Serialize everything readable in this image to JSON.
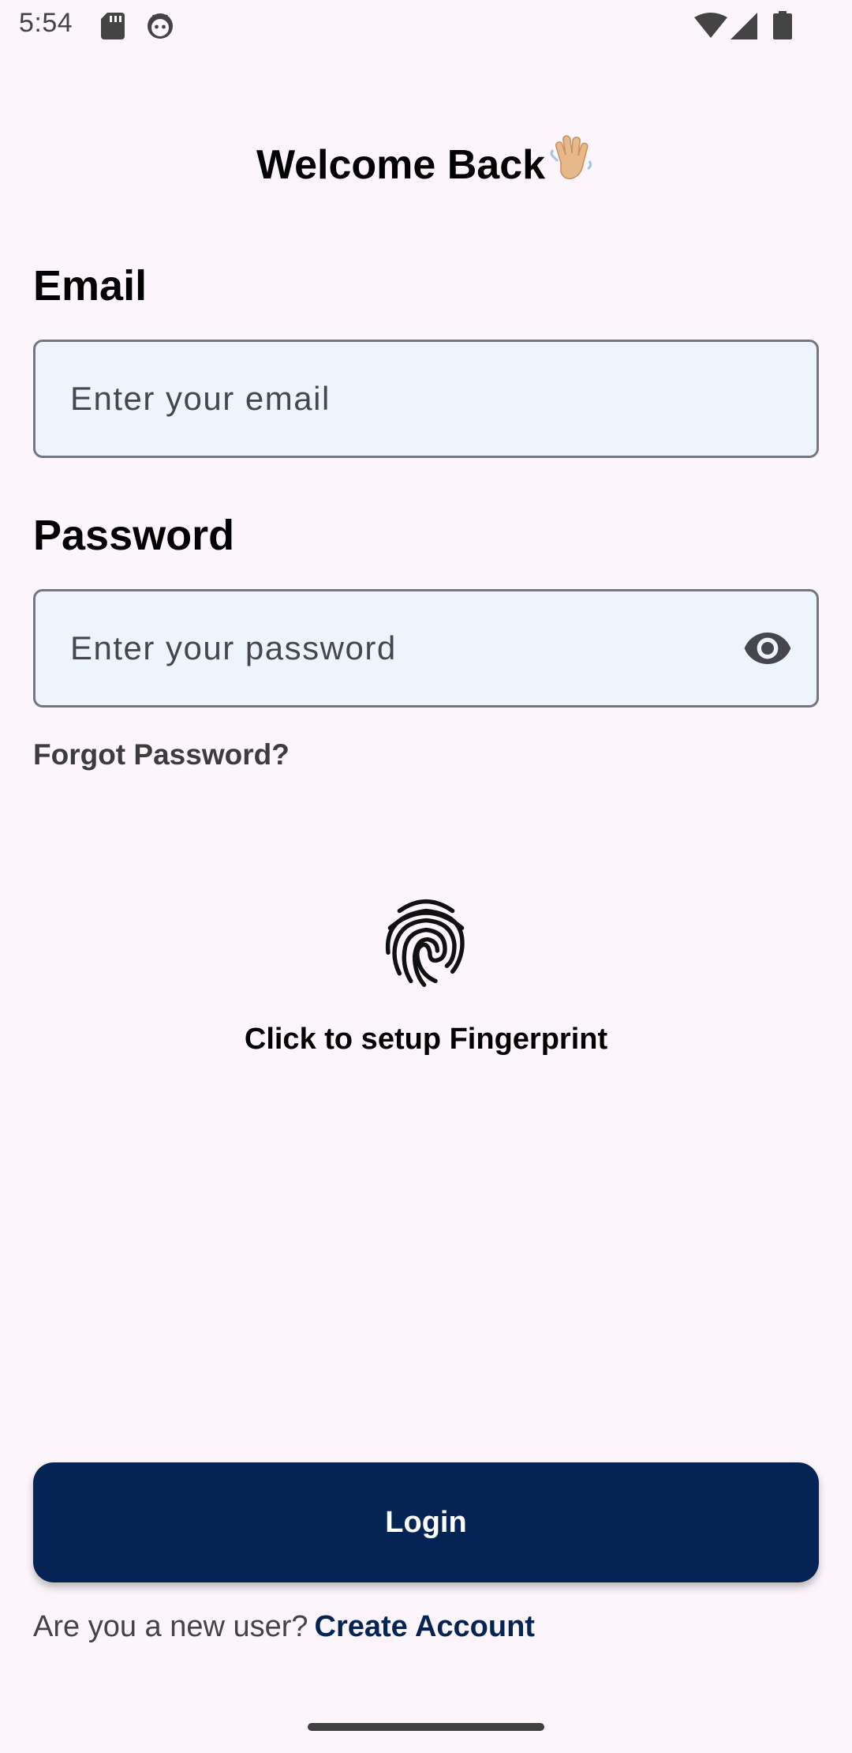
{
  "status_bar": {
    "time": "5:54",
    "left_icons": [
      "sd-card-icon",
      "android-face-icon"
    ],
    "right_icons": [
      "wifi-icon",
      "signal-icon",
      "battery-icon"
    ]
  },
  "header": {
    "title": "Welcome Back",
    "title_emoji": "waving-hand-icon"
  },
  "form": {
    "email_label": "Email",
    "email_placeholder": "Enter your email",
    "password_label": "Password",
    "password_placeholder": "Enter your password",
    "password_toggle_icon": "eye-icon",
    "forgot_password": "Forgot Password?"
  },
  "fingerprint": {
    "icon": "fingerprint-icon",
    "label": "Click to setup Fingerprint"
  },
  "actions": {
    "login_label": "Login",
    "new_user_prompt": "Are you a new user?",
    "create_account": "Create Account"
  },
  "colors": {
    "background": "#fcf5fb",
    "input_fill": "#eef4fd",
    "input_border": "#767680",
    "primary": "#052453",
    "primary_text": "#ffffff"
  }
}
